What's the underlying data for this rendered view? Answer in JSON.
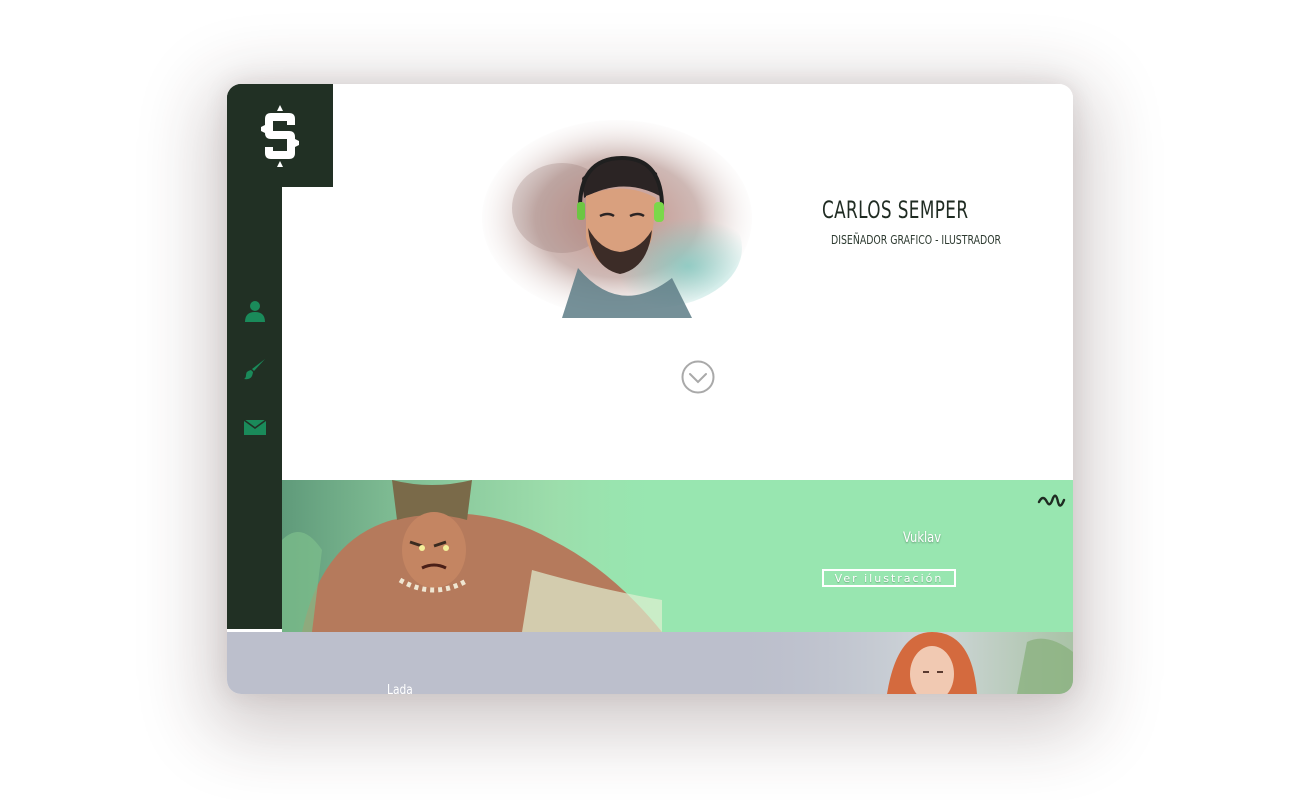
{
  "profile": {
    "name": "CARLOS SEMPER",
    "role": "DISEÑADOR GRAFICO - ILUSTRADOR"
  },
  "nav": {
    "items": [
      {
        "icon": "user-icon"
      },
      {
        "icon": "brush-icon"
      },
      {
        "icon": "mail-icon"
      }
    ]
  },
  "colors": {
    "sidebar": "#213024",
    "accent": "#1a8a5a",
    "green_band": "#98e6b0",
    "grey_band": "#bcbfcc"
  },
  "cards": [
    {
      "title": "Vuklav",
      "button": "Ver ilustración"
    },
    {
      "title": "Lada"
    }
  ]
}
